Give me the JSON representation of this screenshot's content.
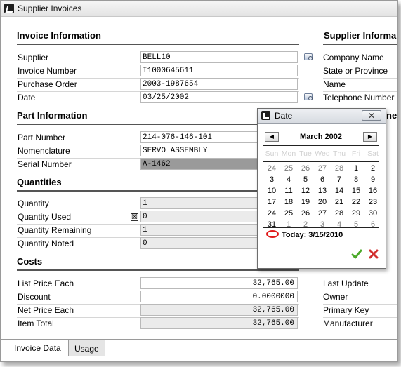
{
  "window": {
    "title": "Supplier Invoices"
  },
  "invoice": {
    "heading": "Invoice Information",
    "fields": [
      {
        "label": "Supplier",
        "value": "BELL10"
      },
      {
        "label": "Invoice Number",
        "value": "I1000645611"
      },
      {
        "label": "Purchase Order",
        "value": "2003-1987654"
      },
      {
        "label": "Date",
        "value": "03/25/2002"
      }
    ]
  },
  "part": {
    "heading": "Part Information",
    "fields": [
      {
        "label": "Part Number",
        "value": "214-076-146-101"
      },
      {
        "label": "Nomenclature",
        "value": "SERVO ASSEMBLY"
      },
      {
        "label": "Serial Number",
        "value": "A-1462"
      }
    ]
  },
  "quantities": {
    "heading": "Quantities",
    "fields": [
      {
        "label": "Quantity",
        "value": "1"
      },
      {
        "label": "Quantity Used",
        "value": "0",
        "checkbox": "☒"
      },
      {
        "label": "Quantity Remaining",
        "value": "1"
      },
      {
        "label": "Quantity Noted",
        "value": "0"
      }
    ]
  },
  "costs": {
    "heading": "Costs",
    "fields": [
      {
        "label": "List Price Each",
        "value": "32,765.00"
      },
      {
        "label": "Discount",
        "value": "0.0000000"
      },
      {
        "label": "Net Price Each",
        "value": "32,765.00"
      },
      {
        "label": "Item Total",
        "value": "32,765.00"
      }
    ]
  },
  "supplier": {
    "heading": "Supplier Informa",
    "fields": [
      "Company Name",
      "State or Province",
      "Name",
      "Telephone Number"
    ]
  },
  "right_lower": {
    "partial_heading": "ne",
    "fields": [
      "Last Update",
      "Owner",
      "Primary Key",
      "Manufacturer"
    ]
  },
  "tabs": [
    "Invoice Data",
    "Usage"
  ],
  "date_popup": {
    "title": "Date",
    "close": "✕",
    "month": "March 2002",
    "prev": "◀",
    "next": "▶",
    "weekdays": [
      "Sun",
      "Mon",
      "Tue",
      "Wed",
      "Thu",
      "Fri",
      "Sat"
    ],
    "weeks": [
      [
        "24",
        "25",
        "26",
        "27",
        "28",
        "1",
        "2"
      ],
      [
        "3",
        "4",
        "5",
        "6",
        "7",
        "8",
        "9"
      ],
      [
        "10",
        "11",
        "12",
        "13",
        "14",
        "15",
        "16"
      ],
      [
        "17",
        "18",
        "19",
        "20",
        "21",
        "22",
        "23"
      ],
      [
        "24",
        "25",
        "26",
        "27",
        "28",
        "29",
        "30"
      ],
      [
        "31",
        "1",
        "2",
        "3",
        "4",
        "5",
        "6"
      ]
    ],
    "other_month": [
      [
        true,
        true,
        true,
        true,
        true,
        false,
        false
      ],
      [
        false,
        false,
        false,
        false,
        false,
        false,
        false
      ],
      [
        false,
        false,
        false,
        false,
        false,
        false,
        false
      ],
      [
        false,
        false,
        false,
        false,
        false,
        false,
        false
      ],
      [
        false,
        false,
        false,
        false,
        false,
        false,
        false
      ],
      [
        false,
        true,
        true,
        true,
        true,
        true,
        true
      ]
    ],
    "today_label": "Today: 3/15/2010",
    "ok_icon": "checkmark-icon",
    "cancel_icon": "x-icon",
    "colors": {
      "ok": "#4caa2a",
      "cancel": "#d23030",
      "today_circle": "#e01a1a"
    }
  }
}
